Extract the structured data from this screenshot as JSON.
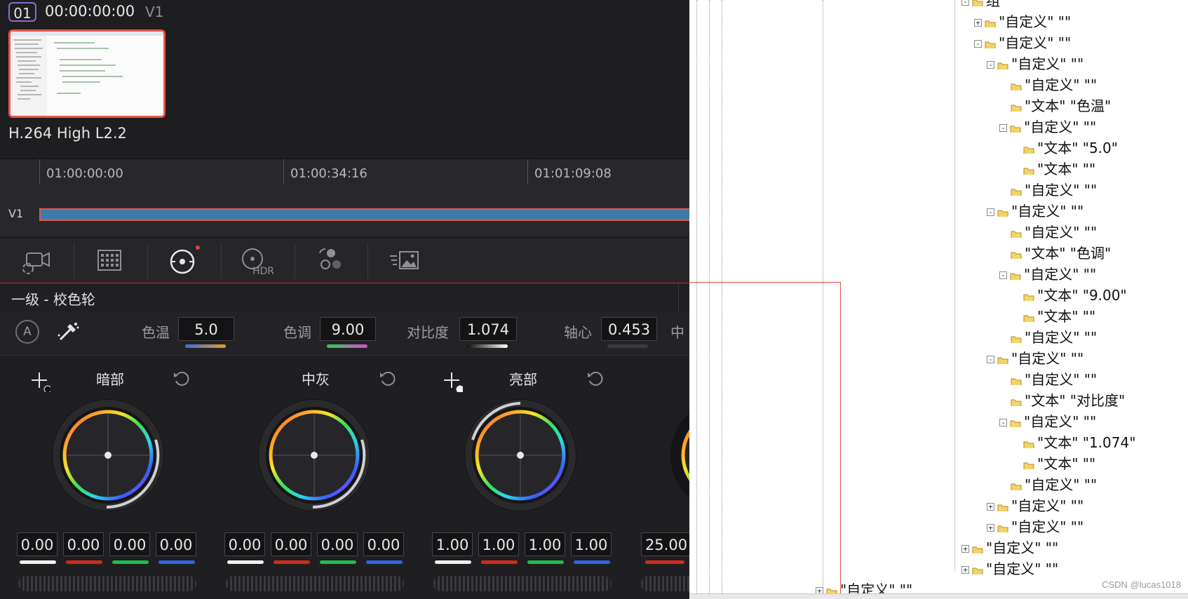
{
  "clip": {
    "number": "01",
    "timecode": "00:00:00:00",
    "track": "V1",
    "codec": "H.264 High L2.2"
  },
  "timeline": {
    "ticks": [
      "01:00:00:00",
      "01:00:34:16",
      "01:01:09:08"
    ],
    "track_label": "V1"
  },
  "toolbar": {
    "hdr_label": "HDR"
  },
  "panel": {
    "title": "一级 - 校色轮",
    "auto_label": "A"
  },
  "params": [
    {
      "label": "色温",
      "value": "5.0"
    },
    {
      "label": "色调",
      "value": "9.00"
    },
    {
      "label": "对比度",
      "value": "1.074"
    },
    {
      "label": "轴心",
      "value": "0.453"
    },
    {
      "label": "中",
      "value": ""
    }
  ],
  "wheels": [
    {
      "title": "暗部",
      "values": [
        "0.00",
        "0.00",
        "0.00",
        "0.00"
      ]
    },
    {
      "title": "中灰",
      "values": [
        "0.00",
        "0.00",
        "0.00",
        "0.00"
      ]
    },
    {
      "title": "亮部",
      "values": [
        "1.00",
        "1.00",
        "1.00",
        "1.00"
      ]
    },
    {
      "title": "",
      "values": [
        "25.00"
      ]
    }
  ],
  "tree": [
    {
      "text": "组",
      "indent": 0,
      "toggle": "-"
    },
    {
      "text": "\"自定义\" \"\"",
      "indent": 1,
      "toggle": "+"
    },
    {
      "text": "\"自定义\" \"\"",
      "indent": 1,
      "toggle": "-"
    },
    {
      "text": "\"自定义\" \"\"",
      "indent": 2,
      "toggle": "-"
    },
    {
      "text": "\"自定义\" \"\"",
      "indent": 3,
      "toggle": ""
    },
    {
      "text": "\"文本\" \"色温\"",
      "indent": 3,
      "toggle": ""
    },
    {
      "text": "\"自定义\" \"\"",
      "indent": 3,
      "toggle": "-"
    },
    {
      "text": "\"文本\" \"5.0\"",
      "indent": 4,
      "toggle": ""
    },
    {
      "text": "\"文本\" \"\"",
      "indent": 4,
      "toggle": ""
    },
    {
      "text": "\"自定义\" \"\"",
      "indent": 3,
      "toggle": ""
    },
    {
      "text": "\"自定义\" \"\"",
      "indent": 2,
      "toggle": "-"
    },
    {
      "text": "\"自定义\" \"\"",
      "indent": 3,
      "toggle": ""
    },
    {
      "text": "\"文本\" \"色调\"",
      "indent": 3,
      "toggle": ""
    },
    {
      "text": "\"自定义\" \"\"",
      "indent": 3,
      "toggle": "-"
    },
    {
      "text": "\"文本\" \"9.00\"",
      "indent": 4,
      "toggle": ""
    },
    {
      "text": "\"文本\" \"\"",
      "indent": 4,
      "toggle": ""
    },
    {
      "text": "\"自定义\" \"\"",
      "indent": 3,
      "toggle": ""
    },
    {
      "text": "\"自定义\" \"\"",
      "indent": 2,
      "toggle": "-"
    },
    {
      "text": "\"自定义\" \"\"",
      "indent": 3,
      "toggle": ""
    },
    {
      "text": "\"文本\" \"对比度\"",
      "indent": 3,
      "toggle": ""
    },
    {
      "text": "\"自定义\" \"\"",
      "indent": 3,
      "toggle": "-"
    },
    {
      "text": "\"文本\" \"1.074\"",
      "indent": 4,
      "toggle": ""
    },
    {
      "text": "\"文本\" \"\"",
      "indent": 4,
      "toggle": ""
    },
    {
      "text": "\"自定义\" \"\"",
      "indent": 3,
      "toggle": ""
    },
    {
      "text": "\"自定义\" \"\"",
      "indent": 2,
      "toggle": "+"
    },
    {
      "text": "\"自定义\" \"\"",
      "indent": 2,
      "toggle": "+"
    },
    {
      "text": "\"自定义\" \"\"",
      "indent": 0,
      "toggle": "+"
    },
    {
      "text": "\"自定义\" \"\"",
      "indent": 0,
      "toggle": "+"
    },
    {
      "text": "\"自定义\" \"\"",
      "indent": -1,
      "toggle": "+"
    }
  ],
  "watermark": "CSDN @lucas1018",
  "colors": {
    "clip_border": "#e8574a",
    "clip_bar": "#3f7aa6",
    "accent_red": "#b5302a",
    "clip_number_border": "#8a6cd6"
  }
}
